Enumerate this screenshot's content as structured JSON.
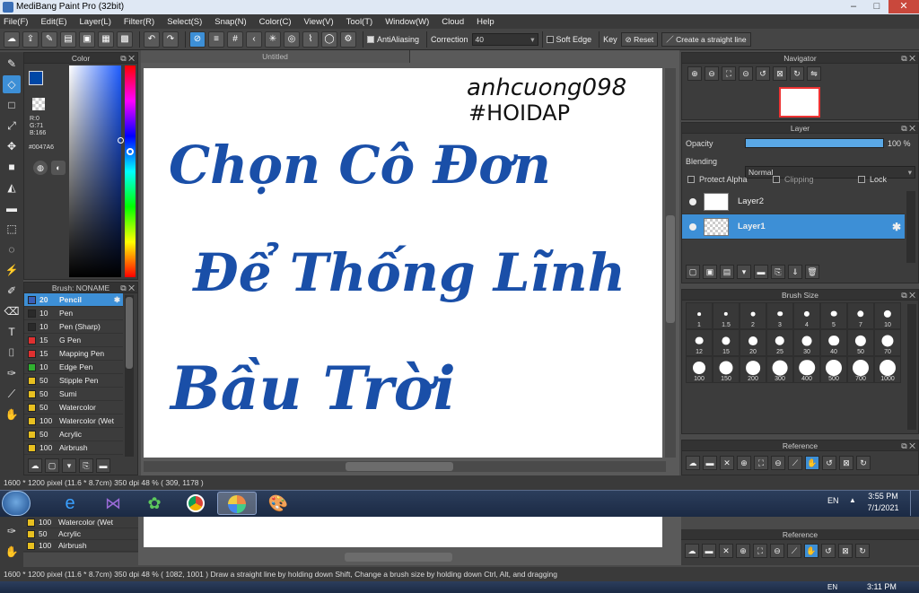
{
  "window": {
    "title": "MediBang Paint Pro (32bit)",
    "min": "–",
    "max": "□",
    "close": "✕"
  },
  "menu": [
    "File(F)",
    "Edit(E)",
    "Layer(L)",
    "Filter(R)",
    "Select(S)",
    "Snap(N)",
    "Color(C)",
    "View(V)",
    "Tool(T)",
    "Window(W)",
    "Cloud",
    "Help"
  ],
  "toolbar": {
    "antialias_label": "AntiAliasing",
    "correction_label": "Correction",
    "correction_value": "40",
    "soft_edge_label": "Soft Edge",
    "key_label": "Key",
    "reset_label": "Reset",
    "straight_line_label": "Create a straight line"
  },
  "color_panel": {
    "title": "Color",
    "r": "R:0",
    "g": "G:71",
    "b": "B:166",
    "hex": "#0047A6",
    "fg_color": "#0047A6"
  },
  "brush_panel": {
    "title": "Brush: NONAME",
    "items": [
      {
        "size": "20",
        "name": "Pencil",
        "color": "#3a5fb8",
        "selected": true
      },
      {
        "size": "10",
        "name": "Pen",
        "color": "#2a2a2a"
      },
      {
        "size": "10",
        "name": "Pen (Sharp)",
        "color": "#2a2a2a"
      },
      {
        "size": "15",
        "name": "G Pen",
        "color": "#e03030"
      },
      {
        "size": "15",
        "name": "Mapping Pen",
        "color": "#e03030"
      },
      {
        "size": "10",
        "name": "Edge Pen",
        "color": "#30b030"
      },
      {
        "size": "50",
        "name": "Stipple Pen",
        "color": "#e8c020"
      },
      {
        "size": "50",
        "name": "Sumi",
        "color": "#e8c020"
      },
      {
        "size": "50",
        "name": "Watercolor",
        "color": "#e8c020"
      },
      {
        "size": "100",
        "name": "Watercolor (Wet",
        "color": "#e8c020"
      },
      {
        "size": "50",
        "name": "Acrylic",
        "color": "#e8c020"
      },
      {
        "size": "100",
        "name": "Airbrush",
        "color": "#e8c020"
      }
    ]
  },
  "document": {
    "tab_title": "Untitled"
  },
  "artwork": {
    "line1": "Chọn Cô Đơn",
    "line2": "Để Thống Lĩnh",
    "line3": "Bầu Trời",
    "signature": "anhcuong098",
    "hashtag": "#HOIDAP",
    "ink_color": "#1a4fa8"
  },
  "navigator": {
    "title": "Navigator"
  },
  "layer_panel": {
    "title": "Layer",
    "opacity_label": "Opacity",
    "opacity_value": "100 %",
    "opacity_level": 1.0,
    "blending_label": "Blending",
    "blending_value": "Normal",
    "protect_alpha": "Protect Alpha",
    "clipping": "Clipping",
    "lock": "Lock",
    "layers": [
      {
        "name": "Layer2",
        "selected": false
      },
      {
        "name": "Layer1",
        "selected": true
      }
    ]
  },
  "brush_size_panel": {
    "title": "Brush Size",
    "sizes": [
      "1",
      "1.5",
      "2",
      "3",
      "4",
      "5",
      "7",
      "10",
      "12",
      "15",
      "20",
      "25",
      "30",
      "40",
      "50",
      "70",
      "100",
      "150",
      "200",
      "300",
      "400",
      "500",
      "700",
      "1000"
    ]
  },
  "reference": {
    "title": "Reference"
  },
  "status": {
    "text": "1600 * 1200 pixel   (11.6 * 8.7cm)   350 dpi   48 %   ( 309, 1178 )"
  },
  "taskbar": {
    "lang": "EN",
    "time": "3:55 PM",
    "date": "7/1/2021"
  },
  "ghost": {
    "status": "1600 * 1200 pixel   (11.6 * 8.7cm)   350 dpi   48 %   ( 1082, 1001 )   Draw a straight line by holding down Shift, Change a brush size by holding down Ctrl, Alt, and dragging",
    "time": "3:11 PM",
    "lang": "EN",
    "reference": "Reference",
    "brush_rows": [
      {
        "size": "100",
        "name": "Watercolor (Wet"
      },
      {
        "size": "50",
        "name": "Acrylic"
      },
      {
        "size": "100",
        "name": "Airbrush"
      }
    ]
  }
}
